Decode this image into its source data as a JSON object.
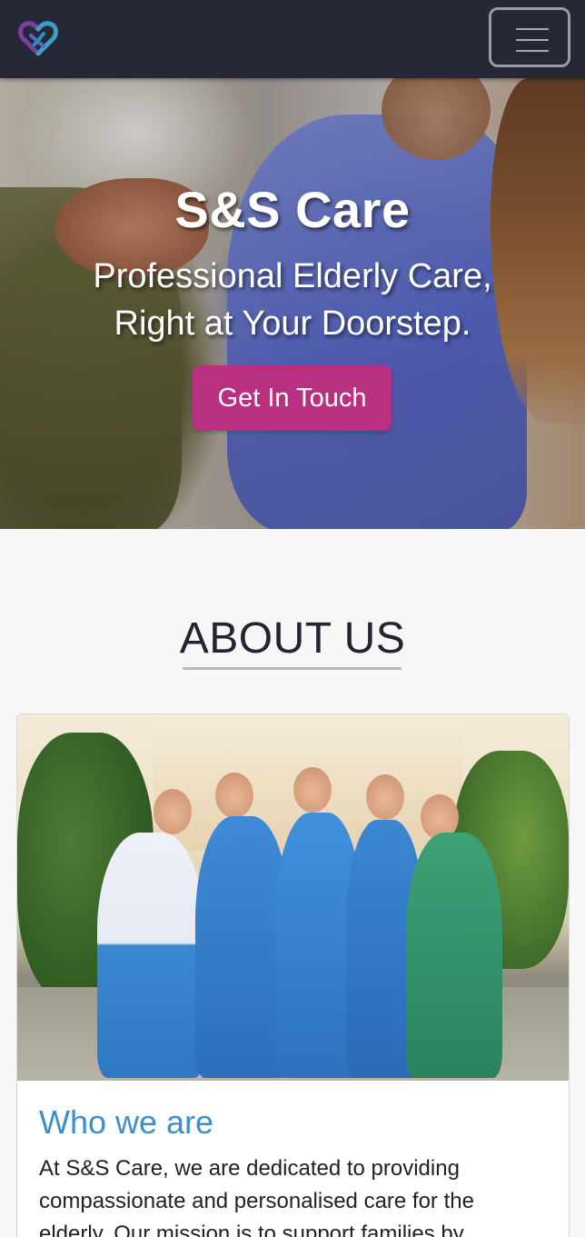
{
  "navbar": {
    "logo_icon": "heart-logo-icon",
    "menu_icon": "hamburger-menu-icon",
    "colors": {
      "background": "#262838",
      "logo_purple": "#7a3fa0",
      "logo_blue": "#3aa0c8"
    }
  },
  "hero": {
    "title": "S&S Care",
    "subtitle": "Professional Elderly Care, Right at Your Doorstep.",
    "cta_label": "Get In Touch",
    "colors": {
      "cta": "#b8307f"
    }
  },
  "about": {
    "title": "ABOUT US",
    "card": {
      "heading": "Who we are",
      "text": "At S&S Care, we are dedicated to providing compassionate and personalised care for the elderly. Our mission is to support families by"
    },
    "colors": {
      "heading": "#3b8fcf"
    }
  }
}
